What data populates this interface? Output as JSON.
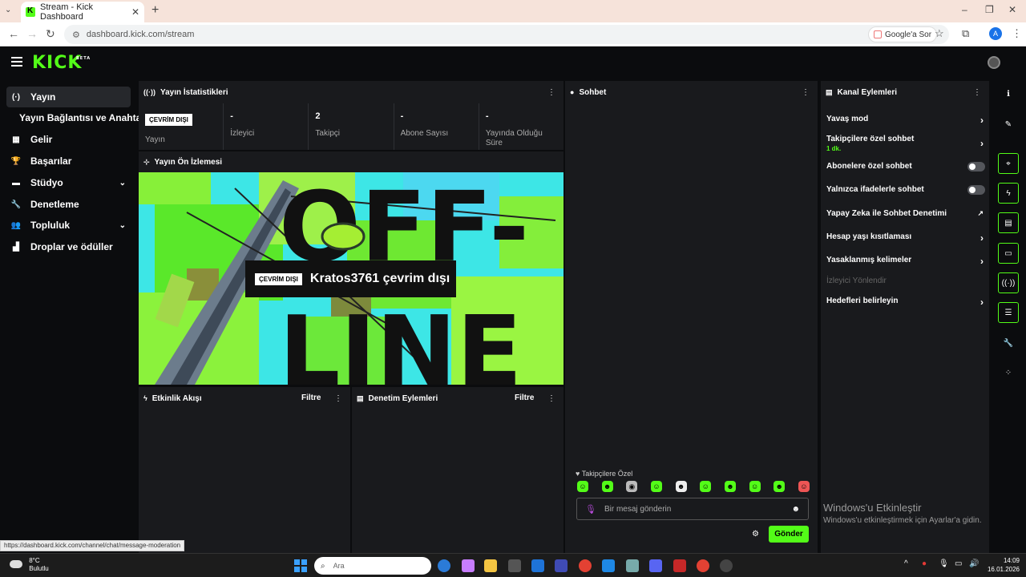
{
  "browser": {
    "tab_title": "Stream - Kick Dashboard",
    "url": "dashboard.kick.com/stream",
    "google_chip": "Google'a Sor",
    "profile_initial": "A",
    "status_url": "https://dashboard.kick.com/channel/chat/message-moderation"
  },
  "app": {
    "logo": "KICK",
    "logo_tag": "BETA"
  },
  "sidebar": {
    "items": [
      {
        "label": "Yayın",
        "icon": "broadcast-icon"
      },
      {
        "label": "Gelir",
        "icon": "chart-icon"
      },
      {
        "label": "Başarılar",
        "icon": "trophy-icon"
      },
      {
        "label": "Stüdyo",
        "icon": "studio-icon"
      },
      {
        "label": "Denetleme",
        "icon": "wrench-icon"
      },
      {
        "label": "Topluluk",
        "icon": "community-icon"
      },
      {
        "label": "Droplar ve ödüller",
        "icon": "drops-icon"
      }
    ],
    "sub_item": "Yayın Bağlantısı ve Anahtarı"
  },
  "stats_panel": {
    "title": "Yayın İstatistikleri",
    "badge": "ÇEVRİM DIŞI",
    "stats": [
      {
        "value": "",
        "label": "Yayın"
      },
      {
        "value": "-",
        "label": "İzleyici"
      },
      {
        "value": "2",
        "label": "Takipçi"
      },
      {
        "value": "-",
        "label": "Abone Sayısı"
      },
      {
        "value": "-",
        "label": "Yayında Olduğu Süre"
      }
    ]
  },
  "preview_panel": {
    "title": "Yayın Ön İzlemesi",
    "badge": "ÇEVRİM DIŞI",
    "offline_text": "Kratos3761 çevrim dışı",
    "art_text_top": "OFF-",
    "art_text_bottom": "LINE"
  },
  "activity_panel": {
    "title": "Etkinlik Akışı",
    "filter": "Filtre"
  },
  "moderation_panel": {
    "title": "Denetim Eylemleri",
    "filter": "Filtre"
  },
  "chat": {
    "title": "Sohbet",
    "followers_only": "Takipçilere Özel",
    "placeholder": "Bir mesaj gönderin",
    "send": "Gönder"
  },
  "channel_actions": {
    "title": "Kanal Eylemleri",
    "rows": [
      {
        "label": "Yavaş mod",
        "control": "chevron"
      },
      {
        "label": "Takipçilere özel sohbet",
        "sub": "1 dk.",
        "control": "chevron"
      },
      {
        "label": "Abonelere özel sohbet",
        "control": "toggle",
        "on": false
      },
      {
        "label": "Yalnızca ifadelerle sohbet",
        "control": "toggle",
        "on": false
      },
      {
        "label": "Yapay Zeka ile Sohbet Denetimi",
        "control": "external"
      },
      {
        "label": "Hesap yaşı kısıtlaması",
        "control": "chevron"
      },
      {
        "label": "Yasaklanmış kelimeler",
        "control": "chevron"
      },
      {
        "label": "İzleyici Yönlendir",
        "control": "none",
        "disabled": true
      },
      {
        "label": "Hedefleri belirleyin",
        "control": "chevron"
      }
    ]
  },
  "watermark": {
    "line1": "Windows'u Etkinleştir",
    "line2": "Windows'u etkinleştirmek için Ayarlar'a gidin."
  },
  "taskbar": {
    "temp": "8°C",
    "weather": "Bulutlu",
    "search": "Ara",
    "time": "14:09",
    "date": "16.01.2026"
  },
  "colors": {
    "accent": "#53fc18",
    "panel": "#191a1d",
    "background": "#0b0c0e"
  }
}
